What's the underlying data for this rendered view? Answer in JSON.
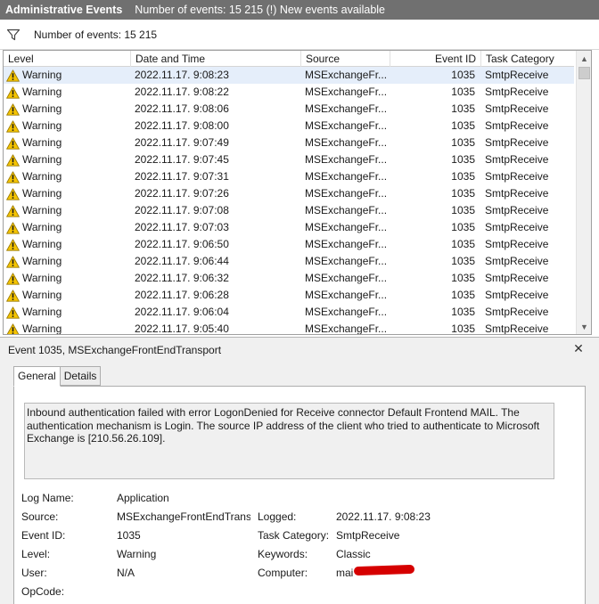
{
  "window": {
    "title": "Administrative Events",
    "subtitle": "Number of events: 15 215 (!) New events available"
  },
  "filter": {
    "icon": "funnel-icon",
    "count_text": "Number of events: 15 215"
  },
  "grid": {
    "columns": [
      "Level",
      "Date and Time",
      "Source",
      "Event ID",
      "Task Category"
    ],
    "rows": [
      {
        "level": "Warning",
        "date": "2022.11.17. 9:08:23",
        "source": "MSExchangeFr...",
        "id": "1035",
        "category": "SmtpReceive"
      },
      {
        "level": "Warning",
        "date": "2022.11.17. 9:08:22",
        "source": "MSExchangeFr...",
        "id": "1035",
        "category": "SmtpReceive"
      },
      {
        "level": "Warning",
        "date": "2022.11.17. 9:08:06",
        "source": "MSExchangeFr...",
        "id": "1035",
        "category": "SmtpReceive"
      },
      {
        "level": "Warning",
        "date": "2022.11.17. 9:08:00",
        "source": "MSExchangeFr...",
        "id": "1035",
        "category": "SmtpReceive"
      },
      {
        "level": "Warning",
        "date": "2022.11.17. 9:07:49",
        "source": "MSExchangeFr...",
        "id": "1035",
        "category": "SmtpReceive"
      },
      {
        "level": "Warning",
        "date": "2022.11.17. 9:07:45",
        "source": "MSExchangeFr...",
        "id": "1035",
        "category": "SmtpReceive"
      },
      {
        "level": "Warning",
        "date": "2022.11.17. 9:07:31",
        "source": "MSExchangeFr...",
        "id": "1035",
        "category": "SmtpReceive"
      },
      {
        "level": "Warning",
        "date": "2022.11.17. 9:07:26",
        "source": "MSExchangeFr...",
        "id": "1035",
        "category": "SmtpReceive"
      },
      {
        "level": "Warning",
        "date": "2022.11.17. 9:07:08",
        "source": "MSExchangeFr...",
        "id": "1035",
        "category": "SmtpReceive"
      },
      {
        "level": "Warning",
        "date": "2022.11.17. 9:07:03",
        "source": "MSExchangeFr...",
        "id": "1035",
        "category": "SmtpReceive"
      },
      {
        "level": "Warning",
        "date": "2022.11.17. 9:06:50",
        "source": "MSExchangeFr...",
        "id": "1035",
        "category": "SmtpReceive"
      },
      {
        "level": "Warning",
        "date": "2022.11.17. 9:06:44",
        "source": "MSExchangeFr...",
        "id": "1035",
        "category": "SmtpReceive"
      },
      {
        "level": "Warning",
        "date": "2022.11.17. 9:06:32",
        "source": "MSExchangeFr...",
        "id": "1035",
        "category": "SmtpReceive"
      },
      {
        "level": "Warning",
        "date": "2022.11.17. 9:06:28",
        "source": "MSExchangeFr...",
        "id": "1035",
        "category": "SmtpReceive"
      },
      {
        "level": "Warning",
        "date": "2022.11.17. 9:06:04",
        "source": "MSExchangeFr...",
        "id": "1035",
        "category": "SmtpReceive"
      },
      {
        "level": "Warning",
        "date": "2022.11.17. 9:05:40",
        "source": "MSExchangeFr...",
        "id": "1035",
        "category": "SmtpReceive"
      }
    ]
  },
  "detail": {
    "title": "Event 1035, MSExchangeFrontEndTransport",
    "tabs": [
      "General",
      "Details"
    ],
    "message": "Inbound authentication failed with error LogonDenied for Receive connector Default Frontend MAIL. The authentication mechanism is Login. The source IP address of the client who tried to authenticate to Microsoft Exchange is [210.56.26.109].",
    "fields": {
      "log_name_label": "Log Name:",
      "log_name": "Application",
      "source_label": "Source:",
      "source": "MSExchangeFrontEndTransport",
      "logged_label": "Logged:",
      "logged": "2022.11.17. 9:08:23",
      "event_id_label": "Event ID:",
      "event_id": "1035",
      "task_category_label": "Task Category:",
      "task_category": "SmtpReceive",
      "level_label": "Level:",
      "level": "Warning",
      "keywords_label": "Keywords:",
      "keywords": "Classic",
      "user_label": "User:",
      "user": "N/A",
      "computer_label": "Computer:",
      "computer": "mai",
      "opcode_label": "OpCode:"
    }
  },
  "colors": {
    "titlebar": "#707070",
    "selected_row": "#e5eefa",
    "warning_yellow": "#f5c400",
    "redaction": "#d60000"
  }
}
